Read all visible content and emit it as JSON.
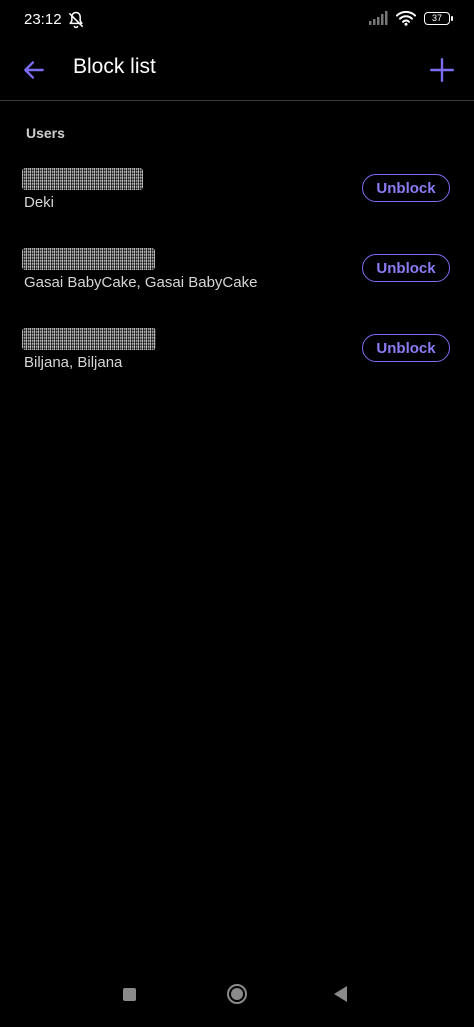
{
  "status_bar": {
    "time": "23:12",
    "battery": "37"
  },
  "app_bar": {
    "title": "Block list"
  },
  "section": {
    "header": "Users"
  },
  "users": [
    {
      "subtitle": "Deki",
      "button_label": "Unblock"
    },
    {
      "subtitle": "Gasai BabyCake, Gasai BabyCake",
      "button_label": "Unblock"
    },
    {
      "subtitle": "Biljana, Biljana",
      "button_label": "Unblock"
    }
  ],
  "colors": {
    "accent": "#7b6cf0",
    "background": "#000000"
  },
  "icons": {
    "back": "arrow-left-icon",
    "add": "plus-icon",
    "mute": "bell-off-icon",
    "signal": "signal-icon",
    "wifi": "wifi-icon"
  }
}
